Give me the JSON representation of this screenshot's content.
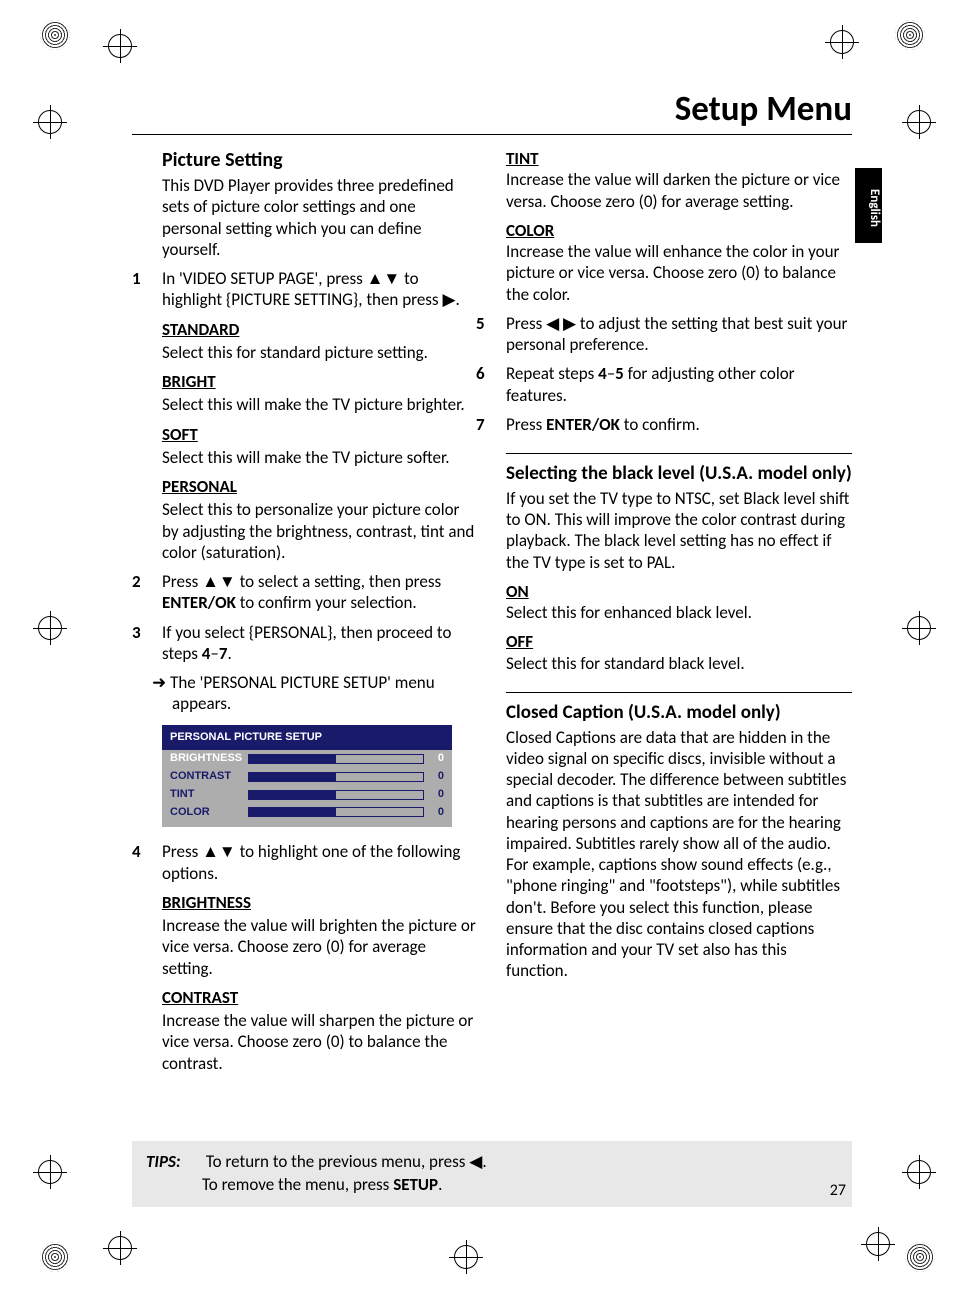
{
  "title": "Setup Menu",
  "langTab": "English",
  "pageNum": "27",
  "col1": {
    "pictureSetting": {
      "heading": "Picture Setting",
      "intro": "This DVD Player provides three predefined sets of picture color settings and one personal setting which you can define yourself.",
      "step1_num": "1",
      "step1_text_a": "In 'VIDEO SETUP PAGE', press ",
      "step1_text_b": " to highlight {PICTURE SETTING}, then press ",
      "step1_text_c": ".",
      "standard_h": "STANDARD",
      "standard": "Select this for standard picture setting.",
      "bright_h": "BRIGHT",
      "bright": "Select this will make the TV picture brighter.",
      "soft_h": "SOFT",
      "soft": "Select this will make the TV picture softer.",
      "personal_h": "PERSONAL",
      "personal": "Select this to personalize your picture color by adjusting the brightness, contrast, tint and color (saturation).",
      "step2_num": "2",
      "step2_a": "Press ",
      "step2_b": " to select a setting, then press ",
      "step2_c": "ENTER/OK",
      "step2_d": " to confirm your selection.",
      "step3_num": "3",
      "step3_a": "If you select {PERSONAL}, then proceed to steps ",
      "step3_b": "4",
      "step3_c": "–",
      "step3_d": "7",
      "step3_e": ".",
      "arrow": "➜ The 'PERSONAL PICTURE SETUP' menu appears.",
      "menu": {
        "title": "PERSONAL PICTURE SETUP",
        "rows": [
          {
            "label": "BRIGHTNESS",
            "value": "0",
            "active": true
          },
          {
            "label": "CONTRAST",
            "value": "0",
            "active": false
          },
          {
            "label": "TINT",
            "value": "0",
            "active": false
          },
          {
            "label": "COLOR",
            "value": "0",
            "active": false
          }
        ]
      },
      "step4_num": "4",
      "step4_a": "Press ",
      "step4_b": " to highlight one of the following options.",
      "brightness_h": "BRIGHTNESS",
      "brightness": "Increase the value will brighten the picture or vice versa. Choose zero (0) for average setting.",
      "contrast_h": "CONTRAST",
      "contrast": "Increase the value will sharpen the picture or vice versa. Choose zero (0) to balance the contrast."
    }
  },
  "col2": {
    "tint_h": "TINT",
    "tint": "Increase the value will darken the picture or vice versa. Choose zero (0) for average setting.",
    "color_h": "COLOR",
    "color": "Increase the value will enhance the color in your picture or vice versa. Choose zero (0) to balance the color.",
    "step5_num": "5",
    "step5_a": "Press ",
    "step5_b": " to adjust the setting that best suit your personal preference.",
    "step6_num": "6",
    "step6_a": "Repeat steps ",
    "step6_b": "4",
    "step6_c": "–",
    "step6_d": "5",
    "step6_e": " for adjusting other color features.",
    "step7_num": "7",
    "step7_a": "Press ",
    "step7_b": "ENTER/OK",
    "step7_c": " to confirm.",
    "black_heading": "Selecting the black level (U.S.A. model only)",
    "black_intro": "If you set the TV type to NTSC, set Black level shift to ON. This will improve the color contrast during playback. The black level setting has no effect if the TV type is set to PAL.",
    "on_h": "ON",
    "on": "Select this for enhanced black level.",
    "off_h": "OFF",
    "off": "Select this for standard black level.",
    "cc_heading": "Closed Caption (U.S.A. model only)",
    "cc": "Closed Captions are data that are hidden in the video signal on specific discs, invisible without a special decoder. The difference between subtitles and captions is that subtitles are intended for hearing persons and captions are for the hearing impaired. Subtitles rarely show all of the audio. For example, captions show sound effects (e.g., \"phone ringing\" and \"footsteps\"), while subtitles don't. Before you select this function, please ensure that the disc contains closed captions information and your TV set also has this function."
  },
  "tips": {
    "label": "TIPS:",
    "line1_a": "To return to the previous menu, press ",
    "line1_b": ".",
    "line2_a": "To remove the menu, press ",
    "line2_b": "SETUP",
    "line2_c": "."
  },
  "icons": {
    "ud": "▲▼",
    "right": "▶",
    "lr": "◀ ▶",
    "left": "◀"
  }
}
